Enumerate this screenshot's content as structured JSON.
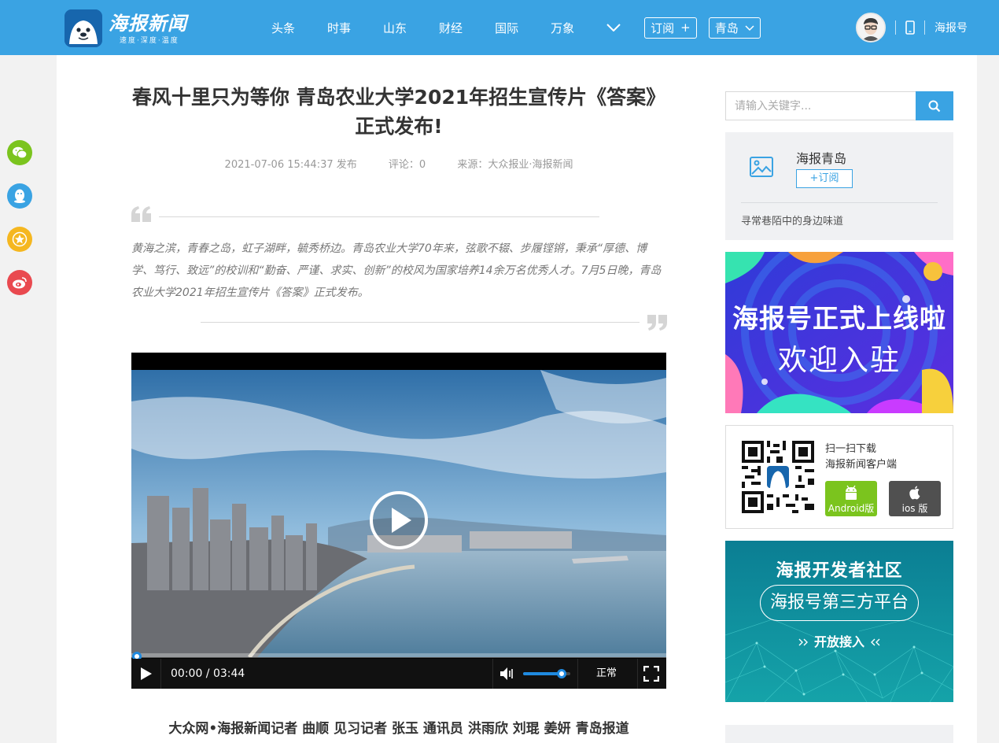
{
  "header": {
    "logo_title": "海报新闻",
    "logo_slogan": "速度·深度·温度",
    "nav": [
      "头条",
      "时事",
      "山东",
      "财经",
      "国际",
      "万象"
    ],
    "subscribe_label": "订阅",
    "subscribe_symbol": "+",
    "city_label": "青岛",
    "account_link": "海报号"
  },
  "share": {
    "icons": [
      "wechat-icon",
      "qq-icon",
      "qzone-icon",
      "weibo-icon"
    ],
    "colors": [
      "#7bc41e",
      "#3aa3e3",
      "#f5b720",
      "#e9494f"
    ]
  },
  "article": {
    "title": "春风十里只为等你 青岛农业大学2021年招生宣传片《答案》正式发布!",
    "datetime": "2021-07-06 15:44:37 发布",
    "comments": "评论：0",
    "source": "来源：大众报业·海报新闻",
    "summary": "黄海之滨，青春之岛，虹子湖畔，毓秀桥边。青岛农业大学70年来，弦歌不辍、步履铿锵，秉承“厚德、博学、笃行、致远”的校训和“勤奋、严谨、求实、创新”的校风为国家培养14余万名优秀人才。7月5日晚，青岛农业大学2021年招生宣传片《答案》正式发布。",
    "byline": "大众网•海报新闻记者 曲顺 见习记者 张玉 通讯员 洪雨欣 刘琨 姜妍 青岛报道"
  },
  "video": {
    "time": "00:00 / 03:44",
    "quality": "正常",
    "progress": 0,
    "volume": 0.8
  },
  "sidebar": {
    "search_placeholder": "请输入关键字...",
    "account_card": {
      "name": "海报青岛",
      "subscribe_label": "+订阅",
      "description": "寻常巷陌中的身边味道"
    },
    "banner1": {
      "line1": "海报号正式上线啦",
      "line2": "欢迎入驻"
    },
    "download": {
      "line1": "扫一扫下载",
      "line2": "海报新闻客户端",
      "android_label": "Android版",
      "ios_label": "ios 版"
    },
    "banner2": {
      "title": "海报开发者社区",
      "pill": "海报号第三方平台",
      "cta": "开放接入"
    }
  },
  "colors": {
    "brand_blue": "#3aa3e3",
    "android_green": "#7bc41e",
    "player_accent": "#1f8ae0"
  }
}
